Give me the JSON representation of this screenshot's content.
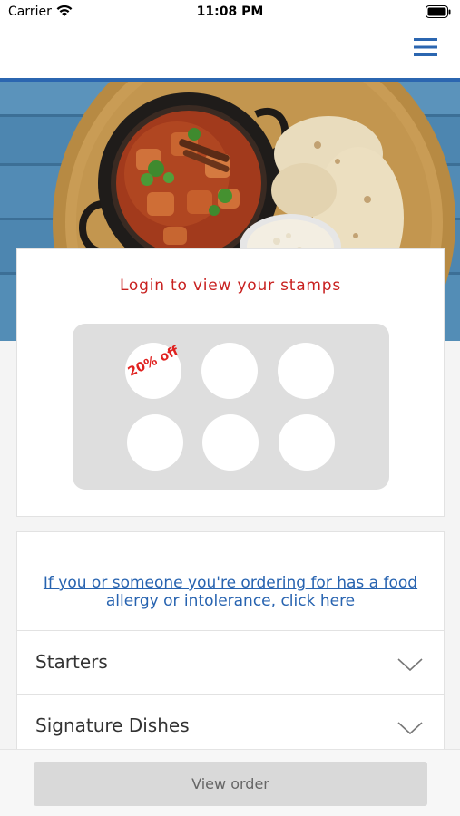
{
  "status_bar": {
    "carrier": "Carrier",
    "time": "11:08 PM"
  },
  "header": {
    "menu_icon": "hamburger-menu-icon",
    "accent_color": "#2b66b0"
  },
  "hero": {
    "image": "curry-dish-with-naan-and-rice"
  },
  "stamps": {
    "title": "Login to view your stamps",
    "reward_text": "20% off",
    "total_stamps": 6,
    "title_color": "#c8201f"
  },
  "menu": {
    "allergy_link": "If you or someone you're ordering for has a food allergy or intolerance, click here",
    "categories": [
      {
        "label": "Starters"
      },
      {
        "label": "Signature Dishes"
      }
    ]
  },
  "footer": {
    "view_order_label": "View order"
  }
}
